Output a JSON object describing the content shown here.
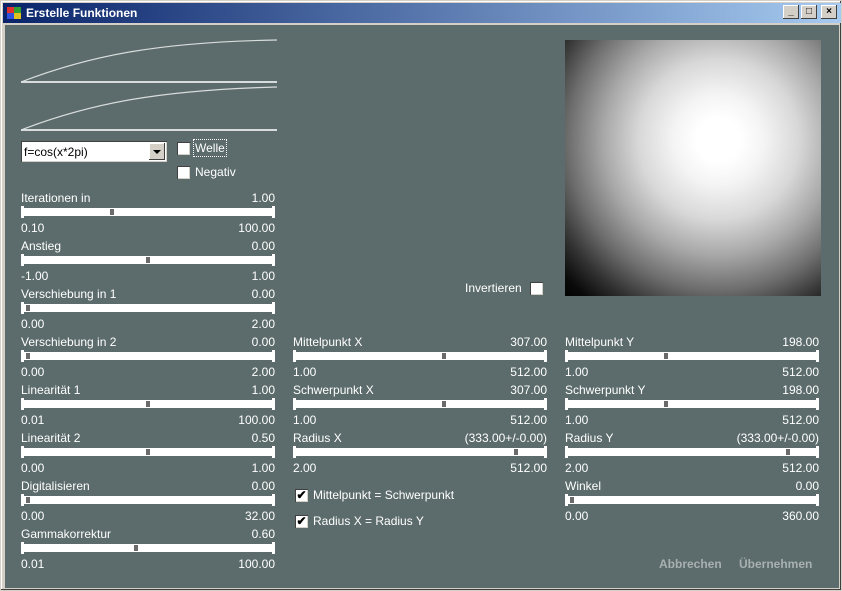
{
  "window": {
    "title": "Erstelle Funktionen"
  },
  "titlebar_buttons": {
    "minimize": "_",
    "maximize": "□",
    "close": "×"
  },
  "function_select": {
    "value": "f=cos(x*2pi)"
  },
  "checkboxes": {
    "welle": {
      "label": "Welle",
      "checked": false
    },
    "negativ": {
      "label": "Negativ",
      "checked": false
    },
    "invertieren": {
      "label": "Invertieren",
      "checked": false
    },
    "mittelpunkt_schwerpunkt": {
      "label": "Mittelpunkt = Schwerpunkt",
      "checked": true,
      "mark": "✔"
    },
    "radius_xy": {
      "label": "Radius X = Radius Y",
      "checked": true,
      "mark": "✔"
    }
  },
  "sliders": {
    "iterationen": {
      "label": "Iterationen in",
      "value": "1.00",
      "min": "0.10",
      "max": "100.00",
      "position": 0.35
    },
    "anstieg": {
      "label": "Anstieg",
      "value": "0.00",
      "min": "-1.00",
      "max": "1.00",
      "position": 0.5
    },
    "verschiebung1": {
      "label": "Verschiebung in 1",
      "value": "0.00",
      "min": "0.00",
      "max": "2.00",
      "position": 0.0
    },
    "verschiebung2": {
      "label": "Verschiebung in 2",
      "value": "0.00",
      "min": "0.00",
      "max": "2.00",
      "position": 0.0
    },
    "linearitaet1": {
      "label": "Linearität 1",
      "value": "1.00",
      "min": "0.01",
      "max": "100.00",
      "position": 0.5
    },
    "linearitaet2": {
      "label": "Linearität 2",
      "value": "0.50",
      "min": "0.00",
      "max": "1.00",
      "position": 0.5
    },
    "digitalisieren": {
      "label": "Digitalisieren",
      "value": "0.00",
      "min": "0.00",
      "max": "32.00",
      "position": 0.0
    },
    "gammakorrektur": {
      "label": "Gammakorrektur",
      "value": "0.60",
      "min": "0.01",
      "max": "100.00",
      "position": 0.45
    },
    "mittelpunkt_x": {
      "label": "Mittelpunkt X",
      "value": "307.00",
      "min": "1.00",
      "max": "512.00",
      "position": 0.6
    },
    "schwerpunkt_x": {
      "label": "Schwerpunkt X",
      "value": "307.00",
      "min": "1.00",
      "max": "512.00",
      "position": 0.6
    },
    "radius_x": {
      "label": "Radius X",
      "value": "(333.00+/-0.00)",
      "min": "2.00",
      "max": "512.00",
      "position": 0.9
    },
    "mittelpunkt_y": {
      "label": "Mittelpunkt Y",
      "value": "198.00",
      "min": "1.00",
      "max": "512.00",
      "position": 0.39
    },
    "schwerpunkt_y": {
      "label": "Schwerpunkt Y",
      "value": "198.00",
      "min": "1.00",
      "max": "512.00",
      "position": 0.39
    },
    "radius_y": {
      "label": "Radius Y",
      "value": "(333.00+/-0.00)",
      "min": "2.00",
      "max": "512.00",
      "position": 0.9
    },
    "winkel": {
      "label": "Winkel",
      "value": "0.00",
      "min": "0.00",
      "max": "360.00",
      "position": 0.0
    }
  },
  "buttons": {
    "cancel": "Abbrechen",
    "apply": "Übernehmen"
  },
  "colors": {
    "background": "#5c6b6b",
    "titlebar": "#0a246a",
    "text": "#ffffff"
  }
}
